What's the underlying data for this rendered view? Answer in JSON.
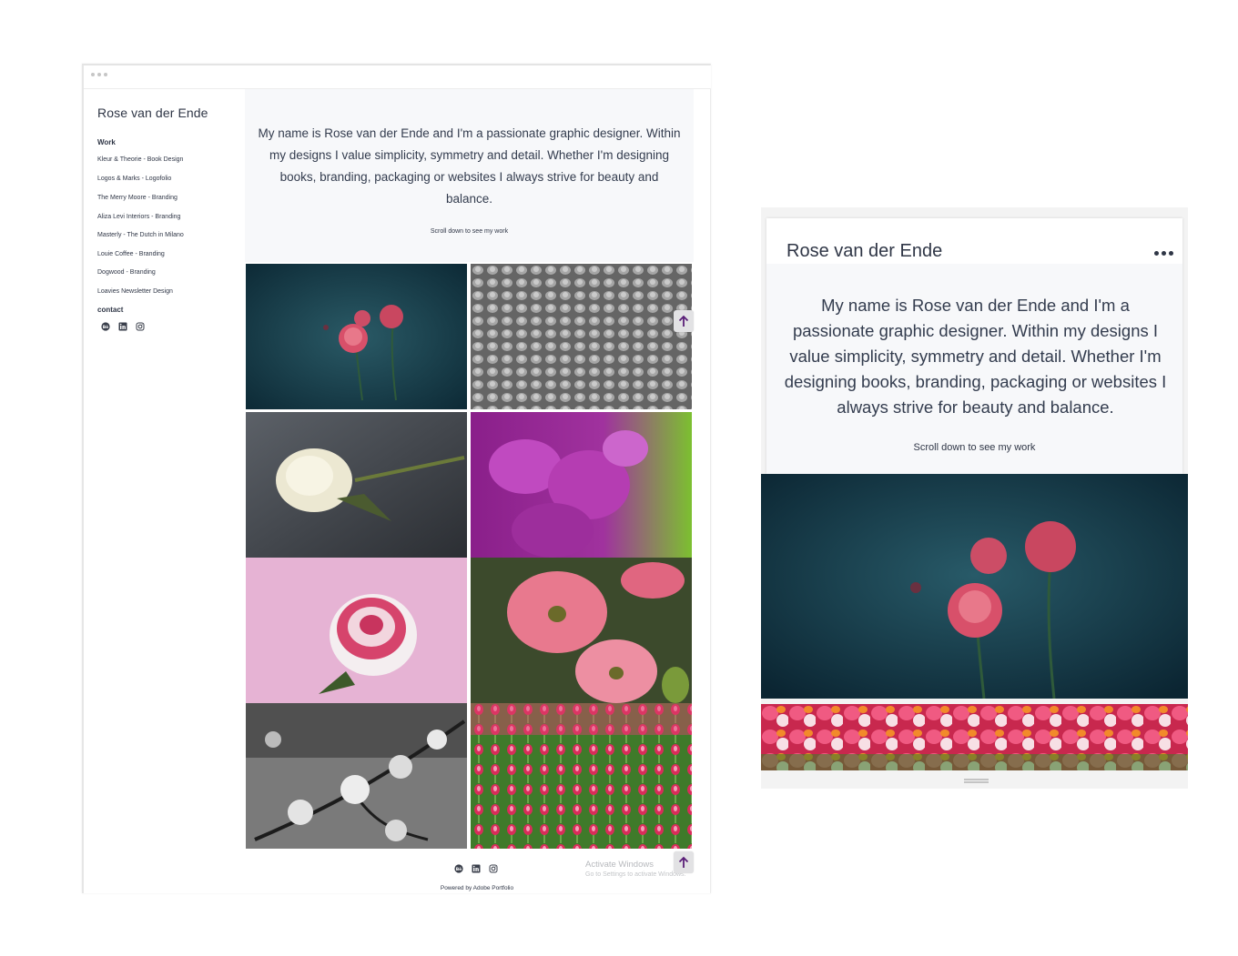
{
  "desktop": {
    "site_title": "Rose van der Ende",
    "nav": {
      "work_heading": "Work",
      "links": [
        "Kleur & Theorie - Book Design",
        "Logos & Marks - Logofolio",
        "The Merry Moore - Branding",
        "Aliza Levi Interiors - Branding",
        "Masterly - The Dutch in Milano",
        "Louie Coffee - Branding",
        "Dogwood - Branding",
        "Loavies Newsletter Design"
      ],
      "contact_heading": "contact"
    },
    "social_icons": [
      "behance-icon",
      "linkedin-icon",
      "instagram-icon"
    ],
    "intro_text": "My name is Rose van der Ende and I'm a passionate graphic designer. Within my designs I value simplicity, symmetry and detail. Whether I'm designing books, branding, packaging or websites I always strive for beauty and balance.",
    "scroll_note": "Scroll down to see my work",
    "gallery": [
      "ranunculus-photo",
      "grayscale-tulip-field-photo",
      "white-rose-photo",
      "purple-flowers-photo",
      "pink-white-rose-photo",
      "pink-dogwood-photo",
      "grayscale-blossom-branch-photo",
      "tulip-field-photo"
    ],
    "powered_by": "Powered by Adobe Portfolio",
    "watermark": {
      "title": "Activate Windows",
      "subtitle": "Go to Settings to activate Windows."
    },
    "accent_color": "#5a1e78"
  },
  "mobile": {
    "site_title": "Rose van der Ende",
    "menu_icon": "more-horizontal-icon",
    "intro_text": "My name is Rose van der Ende and I'm a passionate graphic designer. Within my designs I value simplicity, symmetry and detail. Whether I'm designing books, branding, packaging or websites I always strive for beauty and balance.",
    "scroll_note": "Scroll down to see my work",
    "images": [
      "ranunculus-photo",
      "pink-tulip-field-photo"
    ]
  }
}
